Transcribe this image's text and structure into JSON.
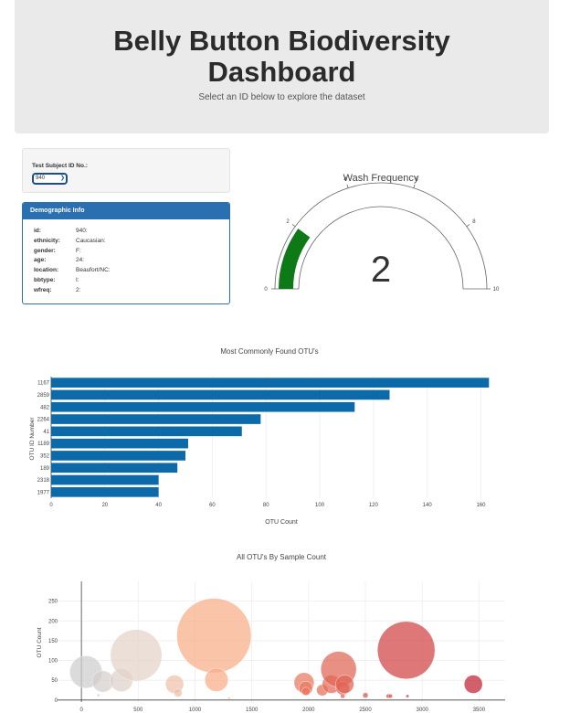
{
  "header": {
    "title_line1": "Belly Button Biodiversity",
    "title_line2": "Dashboard",
    "subtitle": "Select an ID below to explore the dataset"
  },
  "selector": {
    "label": "Test Subject ID No.:",
    "value": "940"
  },
  "demographics": {
    "title": "Demographic Info",
    "rows": [
      {
        "key": "id:",
        "value": "940:"
      },
      {
        "key": "ethnicity:",
        "value": "Caucasian:"
      },
      {
        "key": "gender:",
        "value": "F:"
      },
      {
        "key": "age:",
        "value": "24:"
      },
      {
        "key": "location:",
        "value": "Beaufort/NC:"
      },
      {
        "key": "bbtype:",
        "value": "I:"
      },
      {
        "key": "wfreq:",
        "value": "2:"
      }
    ]
  },
  "colors": {
    "bar": "#0d6aa8",
    "panel": "#2a6faf",
    "gauge_fill": "#0d7a17"
  },
  "chart_data": [
    {
      "type": "gauge",
      "title": "Wash Frequency",
      "value": 2,
      "range": [
        0,
        10
      ],
      "ticks": [
        "0",
        "2",
        "4",
        "6",
        "8",
        "10"
      ]
    },
    {
      "type": "bar",
      "orientation": "horizontal",
      "title": "Most Commonly Found OTU's",
      "xlabel": "OTU Count",
      "ylabel": "OTU ID Number",
      "categories": [
        "1167",
        "2859",
        "482",
        "2264",
        "41",
        "1189",
        "352",
        "189",
        "2318",
        "1977"
      ],
      "values": [
        163,
        126,
        113,
        78,
        71,
        51,
        50,
        47,
        40,
        40
      ],
      "xlim": [
        0,
        168
      ],
      "xticks": [
        0,
        20,
        40,
        60,
        80,
        100,
        120,
        140,
        160
      ]
    },
    {
      "type": "scatter",
      "title": "All OTU's By Sample Count",
      "ylabel": "OTU Count",
      "xlim": [
        -210,
        3730
      ],
      "ylim": [
        -5,
        300
      ],
      "xticks": [
        0,
        500,
        1000,
        1500,
        2000,
        2500,
        3000,
        3500
      ],
      "yticks": [
        0,
        50,
        100,
        150,
        200,
        250
      ],
      "points": [
        {
          "x": 40,
          "y": 71,
          "size": 71
        },
        {
          "x": 189,
          "y": 47,
          "size": 47
        },
        {
          "x": 352,
          "y": 50,
          "size": 50
        },
        {
          "x": 482,
          "y": 113,
          "size": 113
        },
        {
          "x": 150,
          "y": 12,
          "size": 6
        },
        {
          "x": 820,
          "y": 40,
          "size": 40
        },
        {
          "x": 850,
          "y": 18,
          "size": 18
        },
        {
          "x": 1167,
          "y": 163,
          "size": 163
        },
        {
          "x": 1189,
          "y": 51,
          "size": 51
        },
        {
          "x": 1300,
          "y": 5,
          "size": 4
        },
        {
          "x": 1960,
          "y": 44,
          "size": 44
        },
        {
          "x": 1975,
          "y": 30,
          "size": 30
        },
        {
          "x": 1977,
          "y": 22,
          "size": 18
        },
        {
          "x": 2120,
          "y": 25,
          "size": 25
        },
        {
          "x": 2200,
          "y": 40,
          "size": 40
        },
        {
          "x": 2264,
          "y": 78,
          "size": 78
        },
        {
          "x": 2300,
          "y": 30,
          "size": 30
        },
        {
          "x": 2318,
          "y": 40,
          "size": 40
        },
        {
          "x": 2300,
          "y": 10,
          "size": 10
        },
        {
          "x": 2500,
          "y": 12,
          "size": 12
        },
        {
          "x": 2700,
          "y": 10,
          "size": 9
        },
        {
          "x": 2720,
          "y": 10,
          "size": 9
        },
        {
          "x": 2859,
          "y": 126,
          "size": 126
        },
        {
          "x": 2870,
          "y": 10,
          "size": 7
        },
        {
          "x": 3450,
          "y": 40,
          "size": 40
        }
      ]
    }
  ]
}
